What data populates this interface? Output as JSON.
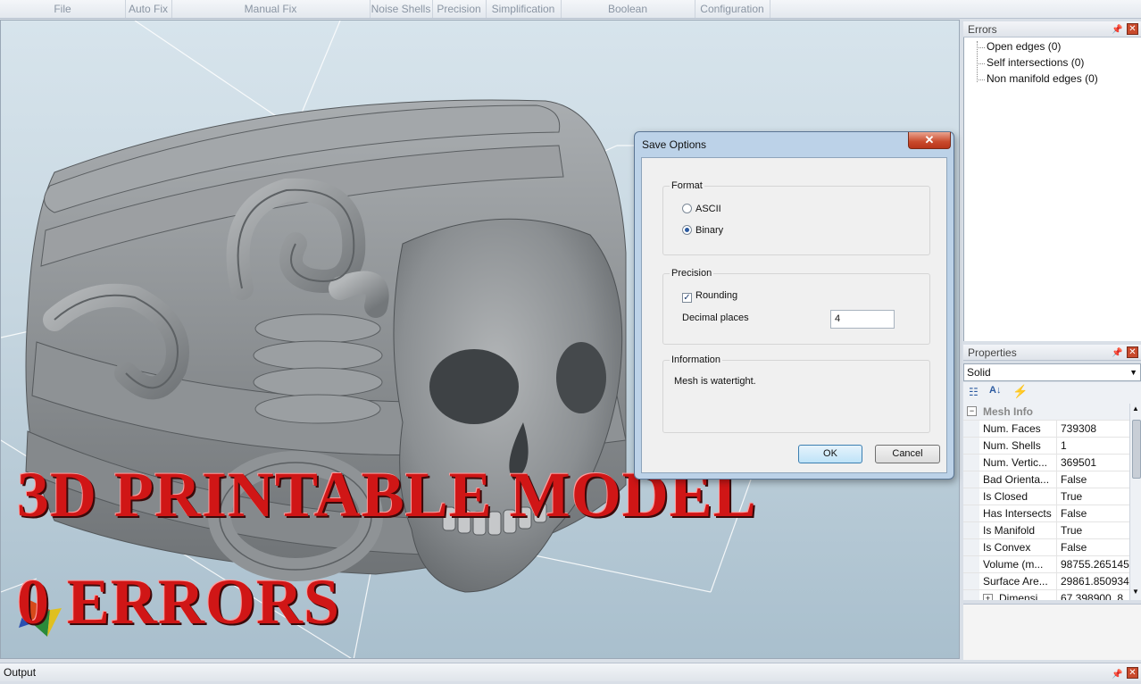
{
  "ribbon": {
    "tabs": [
      "File",
      "Auto Fix",
      "Manual Fix",
      "Noise Shells",
      "Precision",
      "Simplification",
      "Boolean",
      "Configuration"
    ]
  },
  "overlay": {
    "line1": "3D PRINTABLE MODEL",
    "line2": "0 ERRORS"
  },
  "dialog": {
    "title": "Save Options",
    "close_glyph": "✕",
    "format": {
      "legend": "Format",
      "options": [
        "ASCII",
        "Binary"
      ],
      "selected": "Binary"
    },
    "precision": {
      "legend": "Precision",
      "rounding_label": "Rounding",
      "rounding_checked": true,
      "check_glyph": "✓",
      "decimal_label": "Decimal places",
      "decimal_value": "4"
    },
    "information": {
      "legend": "Information",
      "text": "Mesh is watertight."
    },
    "ok_label": "OK",
    "cancel_label": "Cancel"
  },
  "errors_panel": {
    "title": "Errors",
    "items": [
      "Open edges (0)",
      "Self intersections (0)",
      "Non manifold edges (0)"
    ]
  },
  "properties_panel": {
    "title": "Properties",
    "selected_object": "Solid",
    "section": "Mesh Info",
    "rows": [
      {
        "key": "Num. Faces",
        "value": "739308"
      },
      {
        "key": "Num. Shells",
        "value": "1"
      },
      {
        "key": "Num. Vertic...",
        "value": "369501"
      },
      {
        "key": "Bad Orienta...",
        "value": "False"
      },
      {
        "key": "Is Closed",
        "value": "True"
      },
      {
        "key": "Has Intersects",
        "value": "False"
      },
      {
        "key": "Is Manifold",
        "value": "True"
      },
      {
        "key": "Is Convex",
        "value": "False"
      },
      {
        "key": "Volume (m...",
        "value": "98755.265145"
      },
      {
        "key": "Surface Are...",
        "value": "29861.850934"
      },
      {
        "key": "Dimensi...",
        "value": "67.398900, 8..."
      }
    ]
  },
  "output_bar": {
    "title": "Output"
  },
  "colors": {
    "overlay_red": "#d01616",
    "close_red": "#c94a2c",
    "model_gray": "#8f9396"
  }
}
